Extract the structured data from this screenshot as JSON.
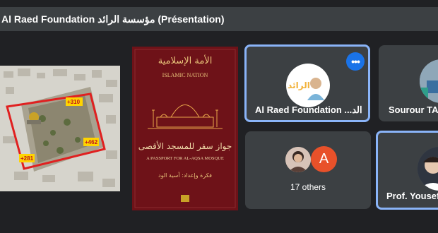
{
  "meeting": {
    "presentation_title": "Al Raed Foundation مؤسسة الرائد (Présentation)"
  },
  "slide": {
    "aerial_labels": [
      "+310",
      "+462",
      "+281"
    ],
    "book_title_arabic": "الأمة الإسلامية",
    "book_series": "ISLAMIC NATION",
    "book_main_arabic": "جواز سفر للمسجد الأقصى",
    "book_main_english": "A PASSPORT FOR AL-AQSA MOSQUE",
    "book_author_arabic": "فكرة وإعداد: آسية الود"
  },
  "participants": [
    {
      "name": "Al Raed Foundation ...الد",
      "logo_text": "الرائد"
    },
    {
      "name": "Sourour TA"
    },
    {
      "name": "17 others",
      "initial": "A"
    },
    {
      "name": "Prof. Yousef"
    }
  ],
  "colors": {
    "active_border": "#8ab4f8",
    "menu_button": "#1a73e8",
    "initial_avatar": "#e8512a",
    "book_cover": "#6e1218"
  }
}
